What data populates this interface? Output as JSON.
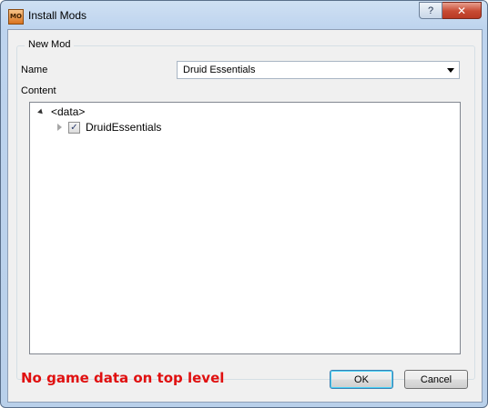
{
  "window": {
    "title": "Install Mods",
    "app_icon_text": "MO",
    "help_glyph": "?",
    "close_glyph": "✕"
  },
  "group": {
    "title": "New Mod"
  },
  "name_field": {
    "label": "Name",
    "value": "Druid Essentials"
  },
  "content": {
    "label": "Content",
    "tree": [
      {
        "text": "<data>",
        "expanded": true,
        "level": 0
      },
      {
        "text": "DruidEssentials",
        "expanded": false,
        "checked": true,
        "level": 1
      }
    ]
  },
  "status": {
    "error_message": "No game data on top level",
    "color": "#e01010"
  },
  "buttons": {
    "ok_label": "OK",
    "cancel_label": "Cancel"
  }
}
